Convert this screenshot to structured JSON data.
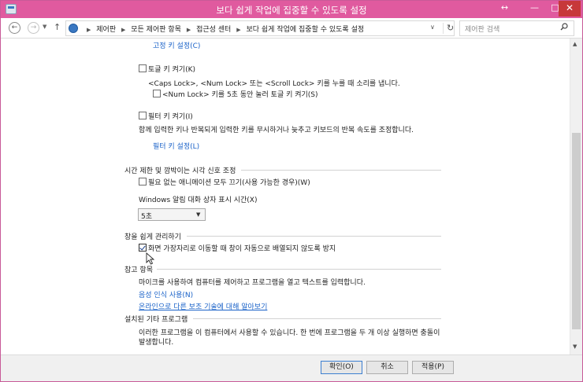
{
  "window": {
    "title": "보다 쉽게 작업에 집중할 수 있도록 설정",
    "controls": {
      "resize": "↔",
      "minimize": "—",
      "maximize": "□",
      "close": "✕"
    }
  },
  "nav": {
    "back": "←",
    "forward": "→",
    "recent": "▼",
    "up": "↑",
    "breadcrumb": [
      "제어판",
      "모든 제어판 항목",
      "접근성 센터",
      "보다 쉽게 작업에 집중할 수 있도록 설정"
    ],
    "breadcrumb_sep": "▶",
    "dropdown": "∨",
    "refresh": "↻",
    "search_placeholder": "제어판 검색"
  },
  "content": {
    "sticky_keys_link": "고정 키 설정(C)",
    "toggle_keys": {
      "label": "토글 키 켜기(K)",
      "checked": false,
      "description": "<Caps Lock>, <Num Lock> 또는 <Scroll Lock> 키를 누를 때 소리를 냅니다.",
      "sub_label": "<Num Lock> 키를 5초 동안 눌러 토글 키 켜기(S)",
      "sub_checked": false
    },
    "filter_keys": {
      "label": "필터 키 켜기(I)",
      "checked": false,
      "description": "함께 입력한 키나 반복되게 입력한 키를 무시하거나 늦추고 키보드의 반복 속도를 조정합니다.",
      "settings_link": "필터 키 설정(L)"
    },
    "time_limits": {
      "heading": "시간 제한 및 깜박이는 시각 신호 조정",
      "animations_label": "필요 없는 애니메이션 모두 끄기(사용 가능한 경우)(W)",
      "animations_checked": false,
      "notification_label": "Windows 알림 대화 상자 표시 시간(X)",
      "notification_value": "5초",
      "notification_arrow": "▼"
    },
    "window_management": {
      "heading": "창을 쉽게 관리하기",
      "snap_label": "화면 가장자리로 이동할 때 창이 자동으로 배열되지 않도록 방지",
      "snap_checked": true
    },
    "see_also": {
      "heading": "참고 항목",
      "description": "마이크를 사용하여 컴퓨터를 제어하고 프로그램을 열고 텍스트를 입력합니다.",
      "speech_link": "음성 인식 사용(N)",
      "online_link": "온라인으로 다른 보조 기술에 대해 알아보기"
    },
    "installed": {
      "heading": "설치된 기타 프로그램",
      "description_line1": "이러한 프로그램을 이 컴퓨터에서 사용할 수 있습니다. 한 번에 프로그램을 두 개 이상 실행하면 충돌이",
      "description_line2": "발생합니다."
    }
  },
  "scrollbar": {
    "up": "▲",
    "down": "▼"
  },
  "buttons": {
    "ok": "확인(O)",
    "cancel": "취소",
    "apply": "적용(P)"
  },
  "colors": {
    "titlebar": "#e05a9f",
    "link": "#1a62c8",
    "close": "#c7383a"
  }
}
